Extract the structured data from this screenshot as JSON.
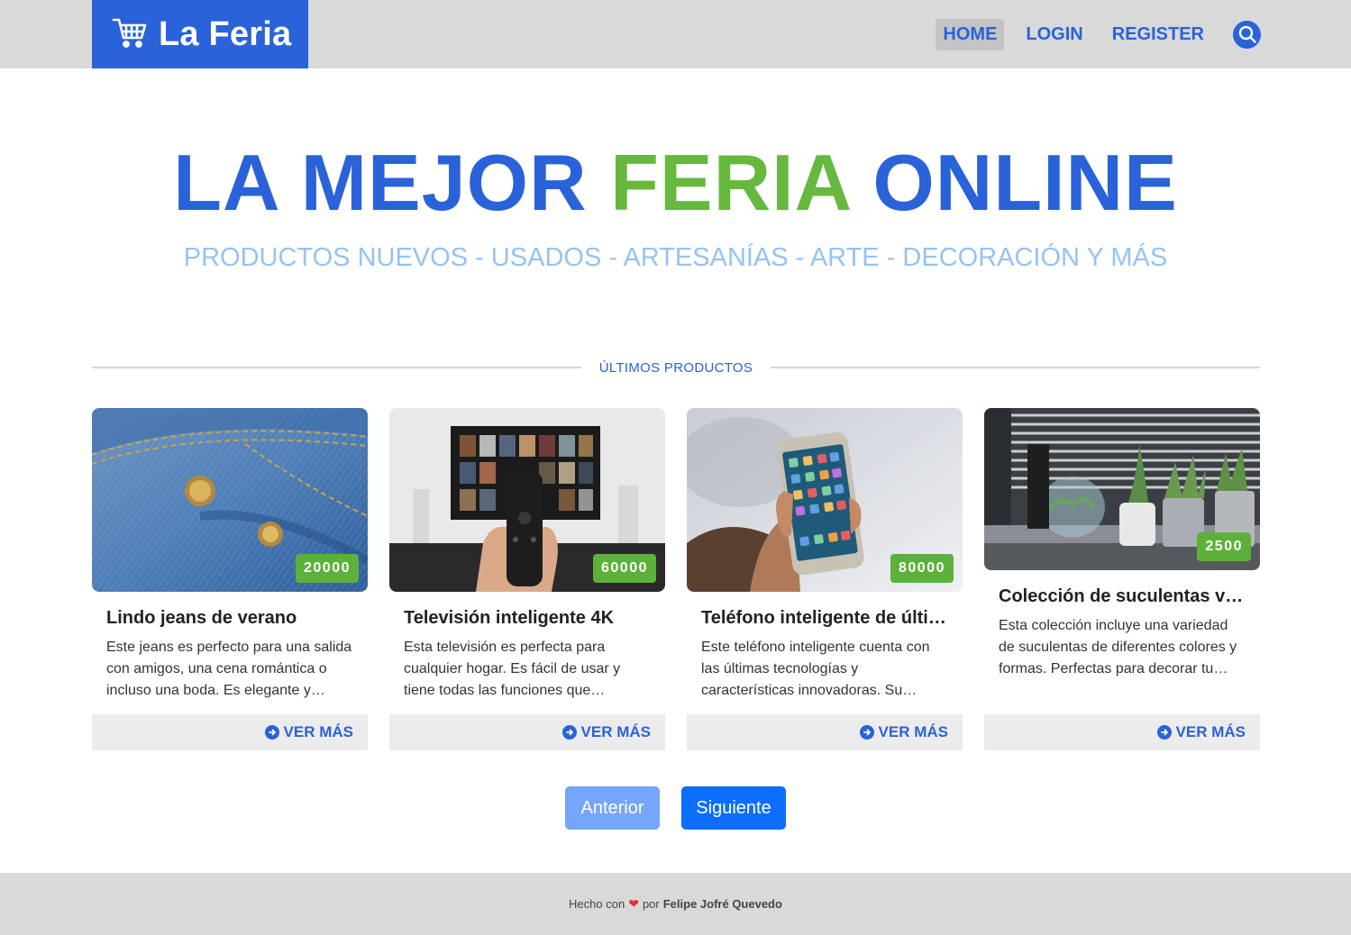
{
  "header": {
    "brand": "La Feria",
    "brand_icon": "shopping-cart-icon",
    "nav": [
      {
        "label": "HOME",
        "active": true
      },
      {
        "label": "LOGIN",
        "active": false
      },
      {
        "label": "REGISTER",
        "active": false
      }
    ],
    "search_icon": "search-icon"
  },
  "hero": {
    "title_part1": "LA MEJOR",
    "title_accent": "FERIA",
    "title_part2": "ONLINE",
    "subtitle": "PRODUCTOS NUEVOS - USADOS - ARTESANÍAS - ARTE - DECORACIÓN Y MÁS"
  },
  "section": {
    "label": "ÚLTIMOS PRODUCTOS"
  },
  "products": [
    {
      "price": "20000",
      "title": "Lindo jeans de verano",
      "description": "Este jeans es perfecto para una salida con amigos, una cena romántica o incluso una boda. Es elegante y…",
      "more": "VER MÁS"
    },
    {
      "price": "60000",
      "title": "Televisión inteligente 4K",
      "description": "Esta televisión es perfecta para cualquier hogar. Es fácil de usar y tiene todas las funciones que…",
      "more": "VER MÁS"
    },
    {
      "price": "80000",
      "title": "Teléfono inteligente de últim…",
      "description": "Este teléfono inteligente cuenta con las últimas tecnologías y características innovadoras. Su…",
      "more": "VER MÁS"
    },
    {
      "price": "2500",
      "title": "Colección de suculentas vari…",
      "description": "Esta colección incluye una variedad de suculentas de diferentes colores y formas. Perfectas para decorar tu…",
      "more": "VER MÁS"
    }
  ],
  "pager": {
    "prev": "Anterior",
    "next": "Siguiente"
  },
  "footer": {
    "made_with": "Hecho con",
    "by": "por",
    "author": "Felipe Jofré Quevedo"
  },
  "colors": {
    "primary": "#2a62d9",
    "accent": "#66b83e",
    "subtitle": "#95c3f3",
    "price_badge": "#5cb13a"
  }
}
